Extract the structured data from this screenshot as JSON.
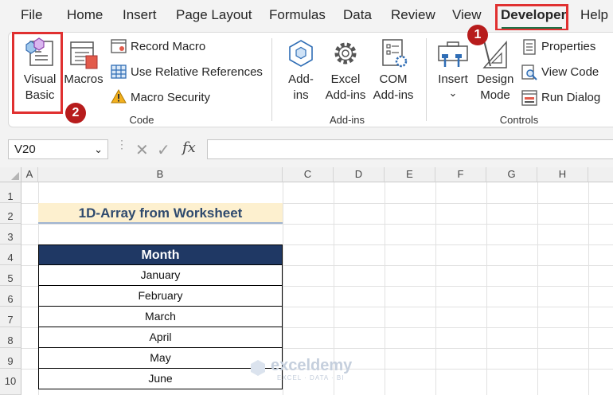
{
  "tabs": [
    "File",
    "Home",
    "Insert",
    "Page Layout",
    "Formulas",
    "Data",
    "Review",
    "View",
    "Developer",
    "Help"
  ],
  "active_tab": "Developer",
  "badges": [
    "1",
    "2"
  ],
  "ribbon": {
    "code": {
      "visual_basic_line1": "Visual",
      "visual_basic_line2": "Basic",
      "macros": "Macros",
      "record_macro": "Record Macro",
      "use_relative_references": "Use Relative References",
      "macro_security": "Macro Security",
      "group_label": "Code"
    },
    "addins": {
      "addins_line1": "Add-",
      "addins_line2": "ins",
      "excel_addins_line1": "Excel",
      "excel_addins_line2": "Add-ins",
      "com_addins_line1": "COM",
      "com_addins_line2": "Add-ins",
      "group_label": "Add-ins"
    },
    "controls": {
      "insert": "Insert",
      "insert_arrow": "⌄",
      "design_mode_line1": "Design",
      "design_mode_line2": "Mode",
      "properties": "Properties",
      "view_code": "View Code",
      "run_dialog": "Run Dialog",
      "group_label": "Controls"
    }
  },
  "formula_bar": {
    "name_box": "V20",
    "fx": "fx",
    "formula": ""
  },
  "columns": [
    "A",
    "B",
    "C",
    "D",
    "E",
    "F",
    "G",
    "H"
  ],
  "rows": [
    "1",
    "2",
    "3",
    "4",
    "5",
    "6",
    "7",
    "8",
    "9",
    "10"
  ],
  "sheet": {
    "title": "1D-Array from Worksheet",
    "header": "Month",
    "months": [
      "January",
      "February",
      "March",
      "April",
      "May",
      "June"
    ]
  },
  "watermark": {
    "name": "exceldemy",
    "tagline": "EXCEL · DATA · BI"
  },
  "colors": {
    "accent": "#1e7145",
    "highlight": "#e03030",
    "badge": "#b71c1c",
    "table_header": "#1f3864",
    "title_fill": "#fdf0cf"
  }
}
